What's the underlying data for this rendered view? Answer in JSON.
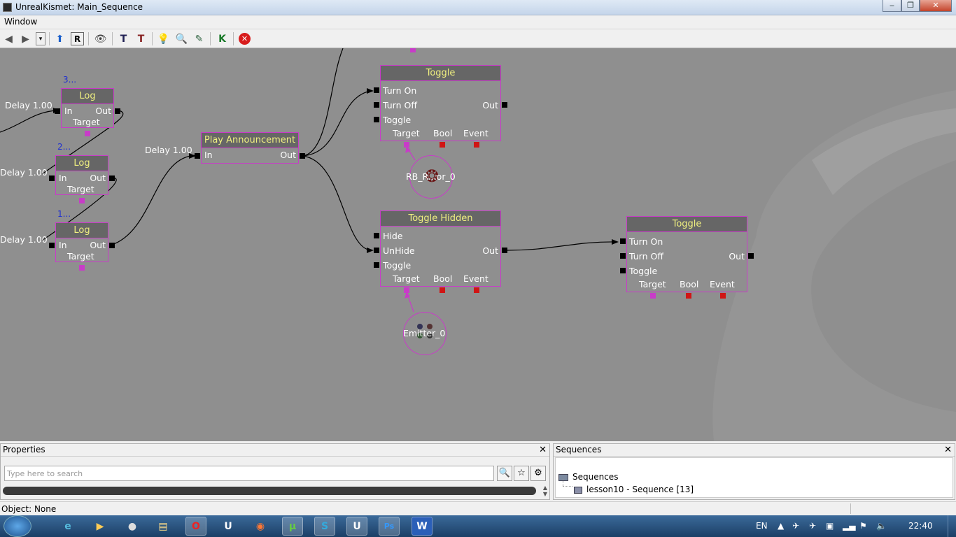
{
  "window": {
    "title": "UnrealKismet: Main_Sequence",
    "minimize": "‒",
    "maximize": "❐",
    "close": "✕"
  },
  "menu": {
    "window": "Window"
  },
  "canvas": {
    "log_nodes": [
      {
        "title": "Log",
        "index": "3...",
        "in": "In",
        "out": "Out",
        "target": "Target",
        "delay": "Delay 1.00"
      },
      {
        "title": "Log",
        "index": "2...",
        "in": "In",
        "out": "Out",
        "target": "Target",
        "delay": "Delay 1.00"
      },
      {
        "title": "Log",
        "index": "1...",
        "in": "In",
        "out": "Out",
        "target": "Target",
        "delay": "Delay 1.00"
      }
    ],
    "play_announcement": {
      "title": "Play Announcement",
      "in": "In",
      "out": "Out",
      "delay": "Delay 1.00"
    },
    "toggle1": {
      "title": "Toggle",
      "turn_on": "Turn On",
      "turn_off": "Turn Off",
      "toggle": "Toggle",
      "out": "Out",
      "target": "Target",
      "bool": "Bool",
      "event": "Event"
    },
    "toggle_hidden": {
      "title": "Toggle Hidden",
      "hide": "Hide",
      "unhide": "UnHide",
      "toggle": "Toggle",
      "out": "Out",
      "target": "Target",
      "bool": "Bool",
      "event": "Event"
    },
    "toggle2": {
      "title": "Toggle",
      "turn_on": "Turn On",
      "turn_off": "Turn Off",
      "toggle": "Toggle",
      "out": "Out",
      "target": "Target",
      "bool": "Bool",
      "event": "Event"
    },
    "var_actor": {
      "label": "RB_R...or_0",
      "icon": "actor-icon"
    },
    "var_emitter": {
      "label": "Emitter_0",
      "icon": "emitter-icon"
    }
  },
  "properties": {
    "title": "Properties",
    "search_placeholder": "Type here to search",
    "close": "✕"
  },
  "sequences": {
    "title": "Sequences",
    "root": "Sequences",
    "child": "lesson10 - Sequence [13]",
    "close": "✕"
  },
  "status": {
    "object": "Object: None"
  },
  "taskbar": {
    "lang": "EN",
    "time": "22:40"
  },
  "colors": {
    "canvas": "#8f8f8f",
    "node_border": "#c83cc8",
    "node_header": "#666666",
    "header_text": "#f0f080",
    "bool_pin": "#d01515"
  }
}
